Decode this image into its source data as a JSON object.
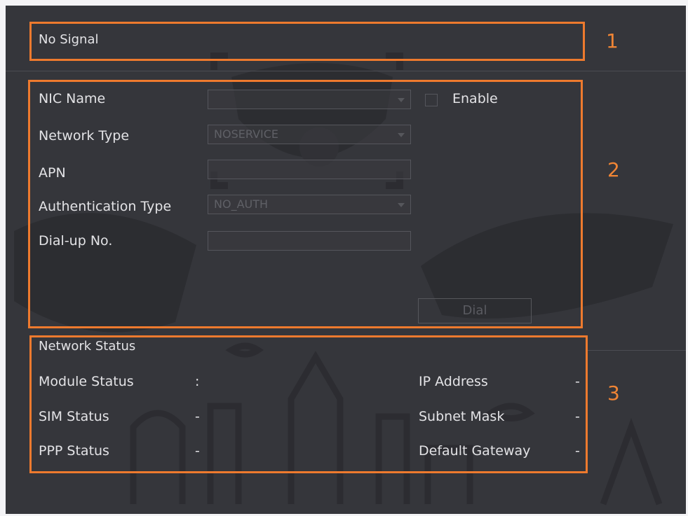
{
  "signal": {
    "text": "No Signal"
  },
  "section_numbers": [
    "1",
    "2",
    "3"
  ],
  "form": {
    "nic_name_label": "NIC Name",
    "nic_name_value": "",
    "enable_label": "Enable",
    "network_type_label": "Network Type",
    "network_type_value": "NOSERVICE",
    "apn_label": "APN",
    "apn_value": "",
    "auth_type_label": "Authentication Type",
    "auth_type_value": "NO_AUTH",
    "dialup_label": "Dial-up No.",
    "dialup_value": "",
    "dial_button": "Dial"
  },
  "status": {
    "title": "Network Status",
    "module_status_label": "Module Status",
    "module_status_value": ":",
    "sim_status_label": "SIM Status",
    "sim_status_value": "-",
    "ppp_status_label": "PPP Status",
    "ppp_status_value": "-",
    "ip_address_label": "IP Address",
    "ip_address_value": "-",
    "subnet_mask_label": "Subnet Mask",
    "subnet_mask_value": "-",
    "default_gateway_label": "Default Gateway",
    "default_gateway_value": "-"
  },
  "colors": {
    "highlight": "#ee7a2e",
    "background": "#35363b"
  }
}
